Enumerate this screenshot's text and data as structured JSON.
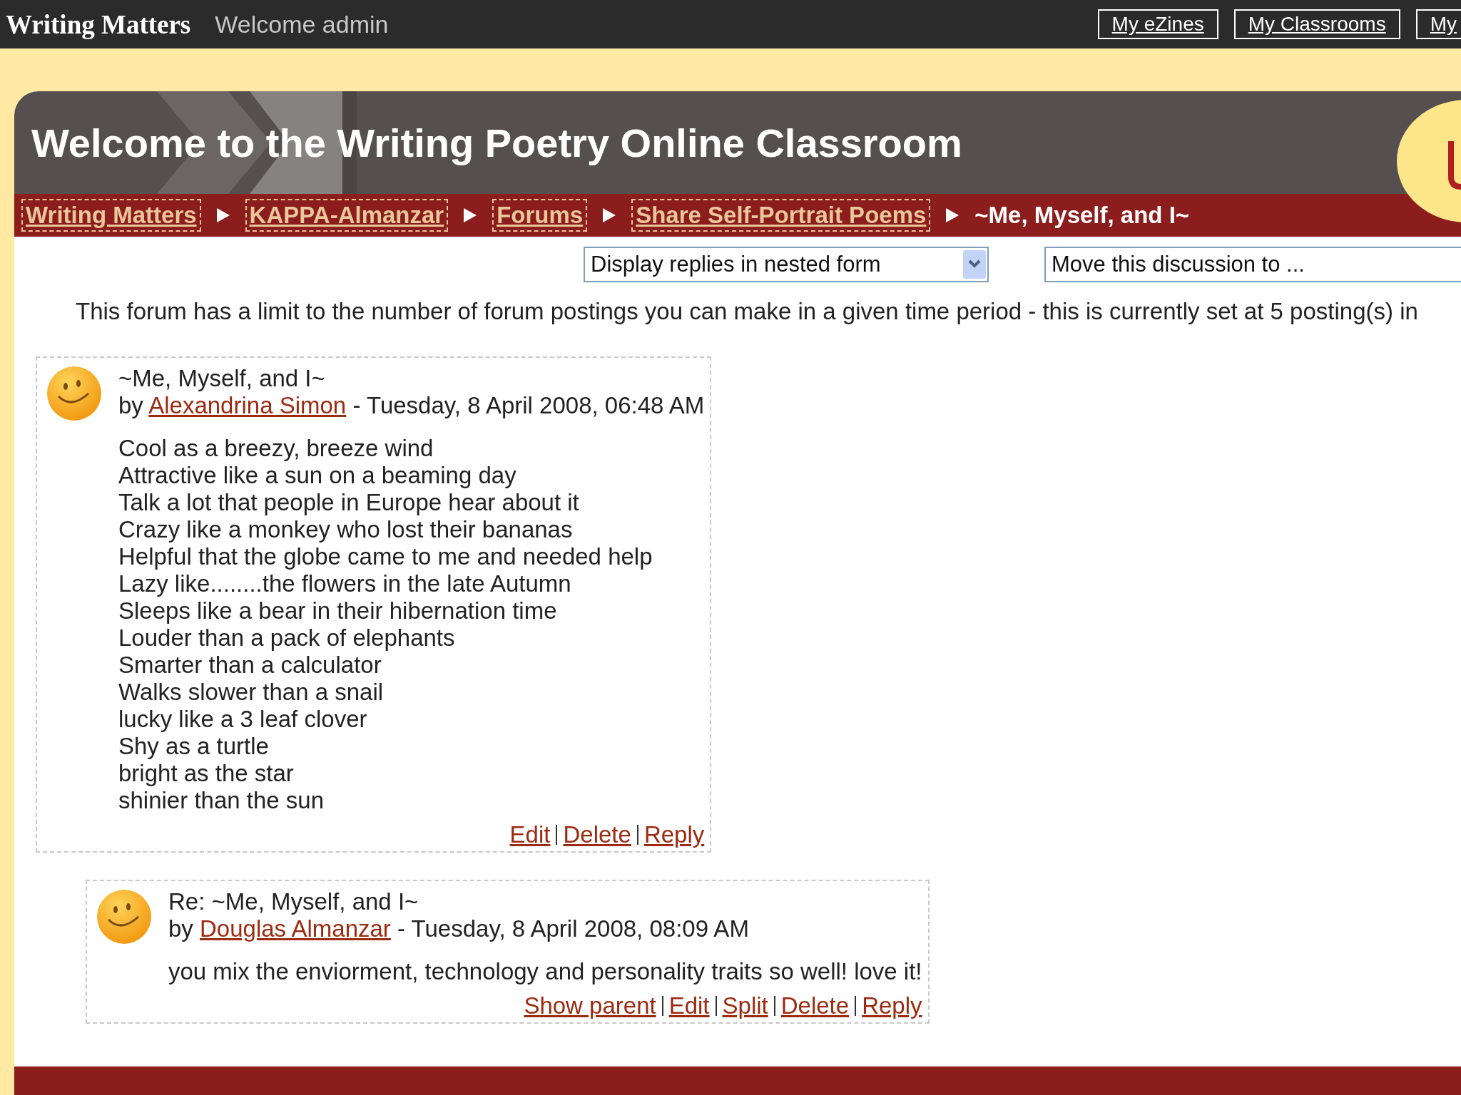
{
  "top_bar": {
    "site_name": "Writing Matters",
    "welcome": "Welcome admin",
    "links": [
      "My eZines",
      "My Classrooms",
      "My"
    ]
  },
  "banner": {
    "title": "Welcome to the Writing Poetry Online Classroom"
  },
  "breadcrumb": {
    "links": [
      "Writing Matters",
      "KAPPA-Almanzar",
      "Forums",
      "Share Self-Portrait Poems"
    ],
    "current": "~Me, Myself, and I~"
  },
  "controls": {
    "display_mode": "Display replies in nested form",
    "move_to": "Move this discussion to ..."
  },
  "notice": "This forum has a limit to the number of forum postings you can make in a given time period - this is currently set at 5 posting(s) in",
  "posts": [
    {
      "subject": "~Me, Myself, and I~",
      "by_label": "by",
      "author": "Alexandrina Simon",
      "date": "- Tuesday, 8 April 2008, 06:48 AM",
      "body": [
        "Cool as a breezy, breeze wind",
        "Attractive like a sun on a beaming day",
        "Talk a lot that people in Europe hear about it",
        "Crazy like a monkey who lost their bananas",
        "Helpful that the globe came to me and needed help",
        "Lazy like........the flowers in the late Autumn",
        "Sleeps like a bear in their hibernation time",
        "Louder than a pack of elephants",
        "Smarter than a calculator",
        "Walks slower than a snail",
        "lucky like a 3 leaf clover",
        "Shy as a turtle",
        "bright as the star",
        "shinier than the sun"
      ],
      "actions": [
        "Edit",
        "Delete",
        "Reply"
      ],
      "children": [
        {
          "subject": "Re: ~Me, Myself, and I~",
          "by_label": "by",
          "author": "Douglas Almanzar",
          "date": "- Tuesday, 8 April 2008, 08:09 AM",
          "body": [
            "you mix the enviorment, technology and personality traits so well! love it!"
          ],
          "actions": [
            "Show parent",
            "Edit",
            "Split",
            "Delete",
            "Reply"
          ]
        }
      ]
    }
  ]
}
